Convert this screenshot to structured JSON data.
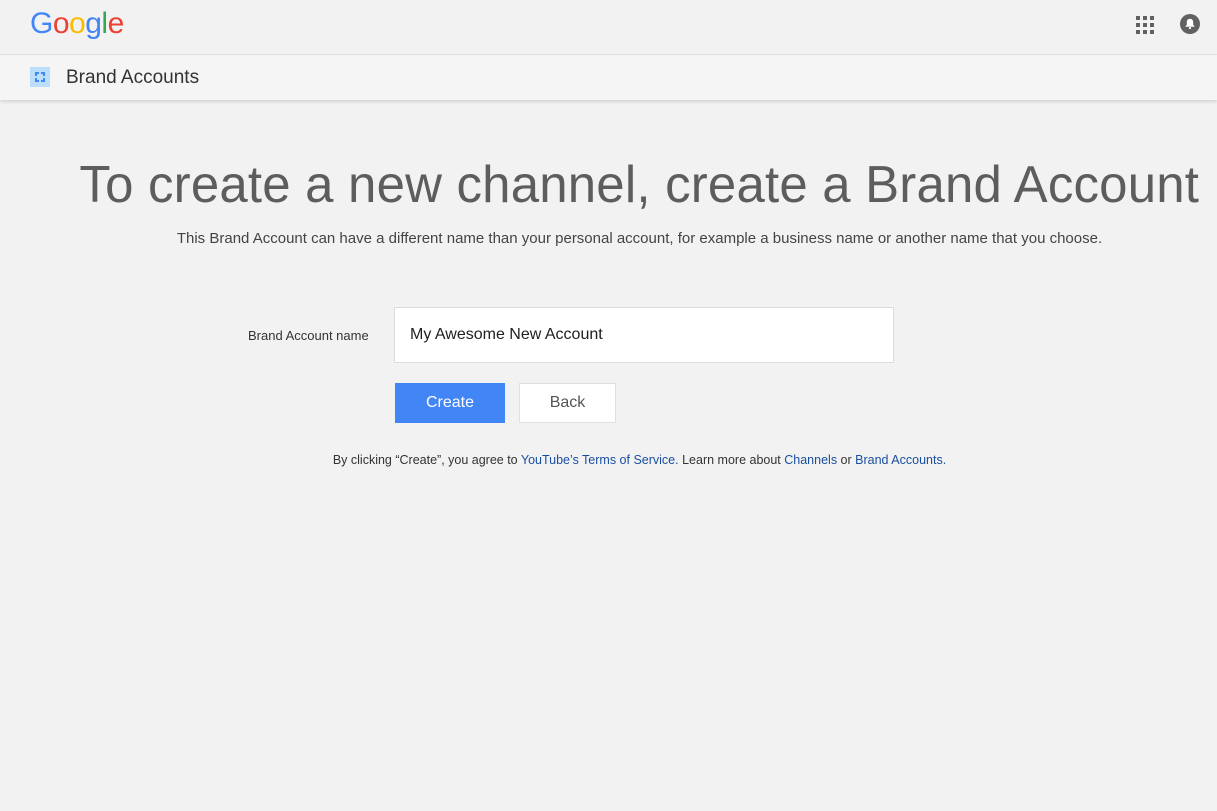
{
  "header": {
    "logo_letters": [
      "G",
      "o",
      "o",
      "g",
      "l",
      "e"
    ],
    "logo_colors": [
      "#4285f4",
      "#ea4335",
      "#fbbc05",
      "#4285f4",
      "#34a853",
      "#ea4335"
    ],
    "apps_icon": "apps-grid-icon",
    "notifications_icon": "notifications-bell-icon"
  },
  "subheader": {
    "icon": "brand-accounts-icon",
    "title": "Brand Accounts"
  },
  "main": {
    "headline": "To create a new channel, create a Brand Account",
    "subtitle": "This Brand Account can have a different name than your personal account, for example a business name or another name that you choose.",
    "form": {
      "name_label": "Brand Account name",
      "name_value": "My Awesome New Account"
    },
    "buttons": {
      "create_label": "Create",
      "back_label": "Back"
    },
    "legal": {
      "prefix": "By clicking “Create”, you agree to ",
      "tos_link": "YouTube’s Terms of Service.",
      "middle": " Learn more about ",
      "channels_link": "Channels",
      "or": " or ",
      "brand_link": "Brand Accounts."
    }
  },
  "colors": {
    "accent": "#4285f4",
    "link": "#1a4fa0",
    "background": "#f2f2f2"
  }
}
